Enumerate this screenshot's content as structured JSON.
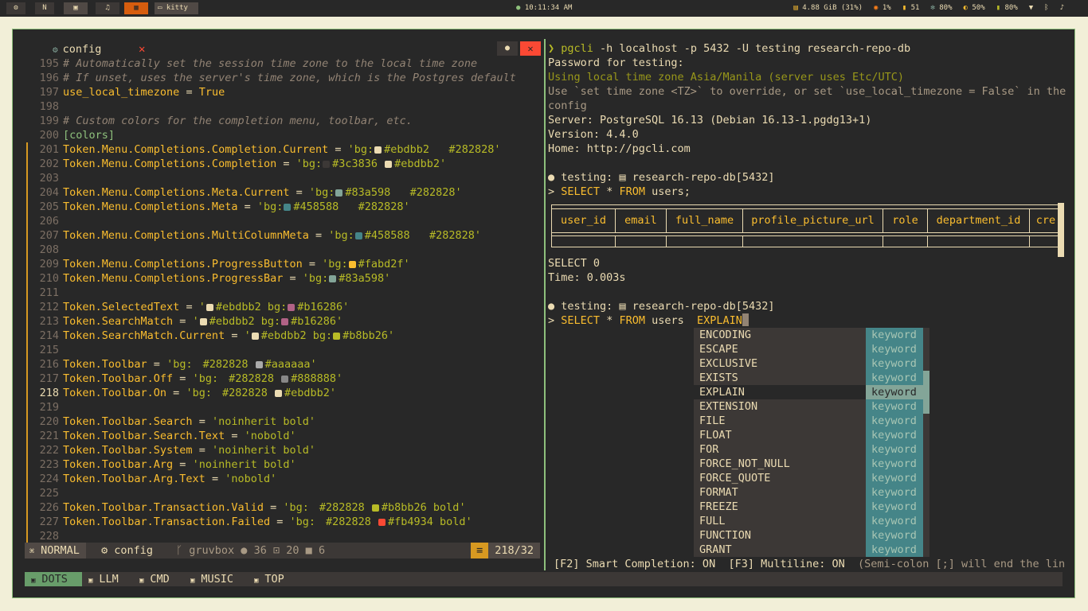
{
  "topbar": {
    "workspaces": [
      {
        "label": "⚙",
        "active": false
      },
      {
        "label": "N",
        "active": false
      },
      {
        "label": "▣",
        "active": false
      },
      {
        "label": "♫",
        "active": false
      },
      {
        "label": "▦",
        "active": true
      }
    ],
    "app_label": "kitty",
    "clock": "10:11:34 AM",
    "memory": "4.88 GiB (31%)",
    "cpu": "1%",
    "temp": "51",
    "brightness": "80%",
    "volume": "50%",
    "battery": "80%"
  },
  "editor": {
    "tab_name": "config",
    "lines": [
      {
        "n": "195",
        "parts": [
          {
            "c": "cm",
            "t": "# Automatically set the session time zone to the local time zone"
          }
        ]
      },
      {
        "n": "196",
        "parts": [
          {
            "c": "cm",
            "t": "# If unset, uses the server's time zone, which is the Postgres default"
          }
        ]
      },
      {
        "n": "197",
        "parts": [
          {
            "c": "kw",
            "t": "use_local_timezone"
          },
          {
            "c": "op",
            "t": " = "
          },
          {
            "c": "kw",
            "t": "True"
          }
        ]
      },
      {
        "n": "198",
        "parts": []
      },
      {
        "n": "199",
        "parts": [
          {
            "c": "cm",
            "t": "# Custom colors for the completion menu, toolbar, etc."
          }
        ]
      },
      {
        "n": "200",
        "parts": [
          {
            "c": "sec",
            "t": "[colors]"
          }
        ]
      },
      {
        "n": "201",
        "parts": [
          {
            "c": "kw",
            "t": "Token.Menu.Completions.Completion.Current"
          },
          {
            "c": "op",
            "t": " = "
          },
          {
            "c": "st",
            "t": "'bg:"
          },
          {
            "sw": "#ebdbb2"
          },
          {
            "c": "st",
            "t": "#ebdbb2   #282828'"
          }
        ]
      },
      {
        "n": "202",
        "parts": [
          {
            "c": "kw",
            "t": "Token.Menu.Completions.Completion"
          },
          {
            "c": "op",
            "t": " = "
          },
          {
            "c": "st",
            "t": "'bg:"
          },
          {
            "sw": "#3c3836"
          },
          {
            "c": "st",
            "t": "#3c3836 "
          },
          {
            "sw": "#ebdbb2"
          },
          {
            "c": "st",
            "t": "#ebdbb2'"
          }
        ]
      },
      {
        "n": "203",
        "parts": []
      },
      {
        "n": "204",
        "parts": [
          {
            "c": "kw",
            "t": "Token.Menu.Completions.Meta.Current"
          },
          {
            "c": "op",
            "t": " = "
          },
          {
            "c": "st",
            "t": "'bg:"
          },
          {
            "sw": "#83a598"
          },
          {
            "c": "st",
            "t": "#83a598   #282828'"
          }
        ]
      },
      {
        "n": "205",
        "parts": [
          {
            "c": "kw",
            "t": "Token.Menu.Completions.Meta"
          },
          {
            "c": "op",
            "t": " = "
          },
          {
            "c": "st",
            "t": "'bg:"
          },
          {
            "sw": "#458588"
          },
          {
            "c": "st",
            "t": "#458588   #282828'"
          }
        ]
      },
      {
        "n": "206",
        "parts": []
      },
      {
        "n": "207",
        "parts": [
          {
            "c": "kw",
            "t": "Token.Menu.Completions.MultiColumnMeta"
          },
          {
            "c": "op",
            "t": " = "
          },
          {
            "c": "st",
            "t": "'bg:"
          },
          {
            "sw": "#458588"
          },
          {
            "c": "st",
            "t": "#458588   #282828'"
          }
        ]
      },
      {
        "n": "208",
        "parts": []
      },
      {
        "n": "209",
        "parts": [
          {
            "c": "kw",
            "t": "Token.Menu.Completions.ProgressButton"
          },
          {
            "c": "op",
            "t": " = "
          },
          {
            "c": "st",
            "t": "'bg:"
          },
          {
            "sw": "#fabd2f"
          },
          {
            "c": "st",
            "t": "#fabd2f'"
          }
        ]
      },
      {
        "n": "210",
        "parts": [
          {
            "c": "kw",
            "t": "Token.Menu.Completions.ProgressBar"
          },
          {
            "c": "op",
            "t": " = "
          },
          {
            "c": "st",
            "t": "'bg:"
          },
          {
            "sw": "#83a598"
          },
          {
            "c": "st",
            "t": "#83a598'"
          }
        ]
      },
      {
        "n": "211",
        "parts": []
      },
      {
        "n": "212",
        "parts": [
          {
            "c": "kw",
            "t": "Token.SelectedText"
          },
          {
            "c": "op",
            "t": " = "
          },
          {
            "c": "st",
            "t": "'"
          },
          {
            "sw": "#ebdbb2"
          },
          {
            "c": "st",
            "t": "#ebdbb2 bg:"
          },
          {
            "sw": "#b16286"
          },
          {
            "c": "st",
            "t": "#b16286'"
          }
        ]
      },
      {
        "n": "213",
        "parts": [
          {
            "c": "kw",
            "t": "Token.SearchMatch"
          },
          {
            "c": "op",
            "t": " = "
          },
          {
            "c": "st",
            "t": "'"
          },
          {
            "sw": "#ebdbb2"
          },
          {
            "c": "st",
            "t": "#ebdbb2 bg:"
          },
          {
            "sw": "#b16286"
          },
          {
            "c": "st",
            "t": "#b16286'"
          }
        ]
      },
      {
        "n": "214",
        "parts": [
          {
            "c": "kw",
            "t": "Token.SearchMatch.Current"
          },
          {
            "c": "op",
            "t": " = "
          },
          {
            "c": "st",
            "t": "'"
          },
          {
            "sw": "#ebdbb2"
          },
          {
            "c": "st",
            "t": "#ebdbb2 bg:"
          },
          {
            "sw": "#b8bb26"
          },
          {
            "c": "st",
            "t": "#b8bb26'"
          }
        ]
      },
      {
        "n": "215",
        "parts": []
      },
      {
        "n": "216",
        "parts": [
          {
            "c": "kw",
            "t": "Token.Toolbar"
          },
          {
            "c": "op",
            "t": " = "
          },
          {
            "c": "st",
            "t": "'bg:"
          },
          {
            "sw": "#282828"
          },
          {
            "c": "st",
            "t": "#282828 "
          },
          {
            "sw": "#aaaaaa"
          },
          {
            "c": "st",
            "t": "#aaaaaa'"
          }
        ]
      },
      {
        "n": "217",
        "parts": [
          {
            "c": "kw",
            "t": "Token.Toolbar.Off"
          },
          {
            "c": "op",
            "t": " = "
          },
          {
            "c": "st",
            "t": "'bg:"
          },
          {
            "sw": "#282828"
          },
          {
            "c": "st",
            "t": "#282828 "
          },
          {
            "sw": "#888888"
          },
          {
            "c": "st",
            "t": "#888888'"
          }
        ]
      },
      {
        "n": "218",
        "cur": true,
        "parts": [
          {
            "c": "kw",
            "t": "Token.Toolbar.On"
          },
          {
            "c": "op",
            "t": " = "
          },
          {
            "c": "st",
            "t": "'bg:"
          },
          {
            "sw": "#282828"
          },
          {
            "c": "st",
            "t": "#282828 "
          },
          {
            "sw": "#ebdbb2"
          },
          {
            "c": "st",
            "t": "#ebdbb2'"
          }
        ]
      },
      {
        "n": "219",
        "parts": []
      },
      {
        "n": "220",
        "parts": [
          {
            "c": "kw",
            "t": "Token.Toolbar.Search"
          },
          {
            "c": "op",
            "t": " = "
          },
          {
            "c": "st",
            "t": "'noinherit bold'"
          }
        ]
      },
      {
        "n": "221",
        "parts": [
          {
            "c": "kw",
            "t": "Token.Toolbar.Search.Text"
          },
          {
            "c": "op",
            "t": " = "
          },
          {
            "c": "st",
            "t": "'nobold'"
          }
        ]
      },
      {
        "n": "222",
        "parts": [
          {
            "c": "kw",
            "t": "Token.Toolbar.System"
          },
          {
            "c": "op",
            "t": " = "
          },
          {
            "c": "st",
            "t": "'noinherit bold'"
          }
        ]
      },
      {
        "n": "223",
        "parts": [
          {
            "c": "kw",
            "t": "Token.Toolbar.Arg"
          },
          {
            "c": "op",
            "t": " = "
          },
          {
            "c": "st",
            "t": "'noinherit bold'"
          }
        ]
      },
      {
        "n": "224",
        "parts": [
          {
            "c": "kw",
            "t": "Token.Toolbar.Arg.Text"
          },
          {
            "c": "op",
            "t": " = "
          },
          {
            "c": "st",
            "t": "'nobold'"
          }
        ]
      },
      {
        "n": "225",
        "parts": []
      },
      {
        "n": "226",
        "parts": [
          {
            "c": "kw",
            "t": "Token.Toolbar.Transaction.Valid"
          },
          {
            "c": "op",
            "t": " = "
          },
          {
            "c": "st",
            "t": "'bg:"
          },
          {
            "sw": "#282828"
          },
          {
            "c": "st",
            "t": "#282828 "
          },
          {
            "sw": "#b8bb26"
          },
          {
            "c": "st",
            "t": "#b8bb26 bold'"
          }
        ]
      },
      {
        "n": "227",
        "parts": [
          {
            "c": "kw",
            "t": "Token.Toolbar.Transaction.Failed"
          },
          {
            "c": "op",
            "t": " = "
          },
          {
            "c": "st",
            "t": "'bg:"
          },
          {
            "sw": "#282828"
          },
          {
            "c": "st",
            "t": "#282828 "
          },
          {
            "sw": "#fb4934"
          },
          {
            "c": "st",
            "t": "#fb4934 bold'"
          }
        ]
      },
      {
        "n": "228",
        "parts": []
      }
    ],
    "status": {
      "mode": "NORMAL",
      "file": "config",
      "theme": "gruvbox",
      "count_a": "36",
      "count_b": "20",
      "count_c": "6",
      "position": "218/32"
    }
  },
  "bottom_tabs": [
    "DOTS",
    "LLM",
    "CMD",
    "MUSIC",
    "TOP"
  ],
  "terminal": {
    "command": "pgcli -h localhost -p 5432 -U testing research-repo-db",
    "prog": "pgcli",
    "args": " -h localhost -p 5432 -U testing research-repo-db",
    "password_prompt": "Password for testing:",
    "timezone_msg": "Using local time zone Asia/Manila (server uses Etc/UTC)",
    "override_msg_1": "Use `set time zone <TZ>` to override, or set `use_local_timezone = False` in the",
    "override_msg_2": "config",
    "server": "Server: PostgreSQL 16.13 (Debian 16.13-1.pgdg13+1)",
    "version": "Version: 4.4.0",
    "home": "Home: http://pgcli.com",
    "prompt_user": "testing:",
    "prompt_db": "research-repo-db[5432]",
    "query1_kw1": "SELECT",
    "query1_star": " * ",
    "query1_kw2": "FROM",
    "query1_rest": " users;",
    "table_headers": [
      "user_id",
      "email",
      "full_name",
      "profile_picture_url",
      "role",
      "department_id",
      "cre"
    ],
    "result_rows": "SELECT 0",
    "result_time": "Time: 0.003s",
    "query2_rest": " users  ",
    "query2_typed": "EXPLAIN",
    "completions": [
      {
        "word": "ENCODING",
        "meta": "keyword"
      },
      {
        "word": "ESCAPE",
        "meta": "keyword"
      },
      {
        "word": "EXCLUSIVE",
        "meta": "keyword"
      },
      {
        "word": "EXISTS",
        "meta": "keyword"
      },
      {
        "word": "EXPLAIN",
        "meta": "keyword",
        "selected": true
      },
      {
        "word": "EXTENSION",
        "meta": "keyword"
      },
      {
        "word": "FILE",
        "meta": "keyword"
      },
      {
        "word": "FLOAT",
        "meta": "keyword"
      },
      {
        "word": "FOR",
        "meta": "keyword"
      },
      {
        "word": "FORCE_NOT_NULL",
        "meta": "keyword"
      },
      {
        "word": "FORCE_QUOTE",
        "meta": "keyword"
      },
      {
        "word": "FORMAT",
        "meta": "keyword"
      },
      {
        "word": "FREEZE",
        "meta": "keyword"
      },
      {
        "word": "FULL",
        "meta": "keyword"
      },
      {
        "word": "FUNCTION",
        "meta": "keyword"
      },
      {
        "word": "GRANT",
        "meta": "keyword"
      }
    ],
    "toolbar_main": "[F2] Smart Completion: ON  [F3] Multiline: ON",
    "toolbar_hint": "  (Semi-colon [;] will end the lin"
  }
}
